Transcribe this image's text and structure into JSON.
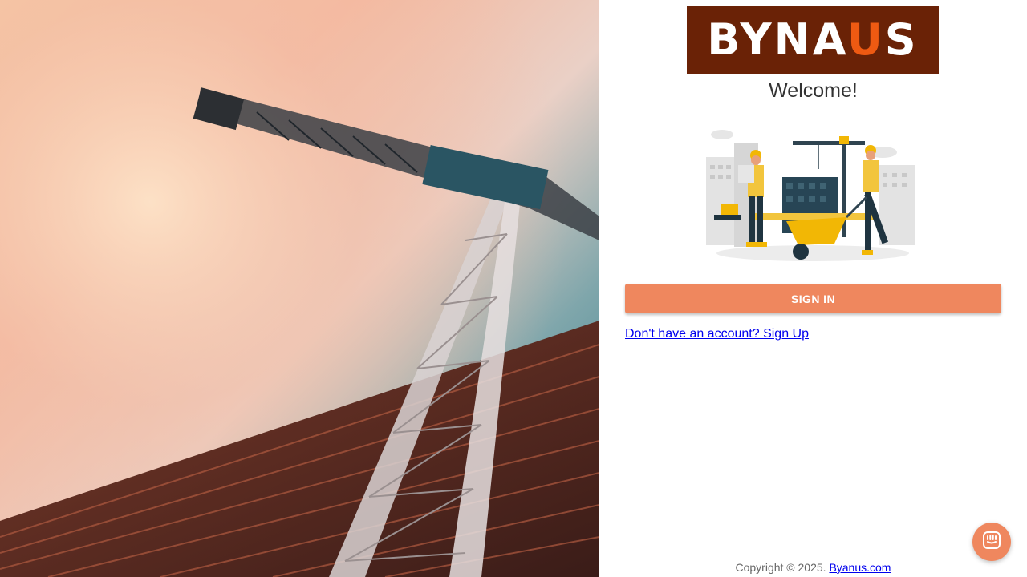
{
  "hero": {
    "image": "construction-crane-photo"
  },
  "brand": {
    "logo_text_part1": "BYNA",
    "logo_text_accent": "U",
    "logo_text_part2": "S",
    "logo_bg_color": "#6a2206",
    "logo_accent_color": "#ef5a12"
  },
  "welcome": {
    "title": "Welcome!"
  },
  "illustration": {
    "image": "construction-workers-illustration"
  },
  "auth": {
    "signin_label": "SIGN IN",
    "signup_link_text": "Don't have an account? Sign Up",
    "button_color": "#ef875e"
  },
  "footer": {
    "copyright_text": "Copyright © 2025.",
    "site_link_text": "Byanus.com"
  },
  "chat": {
    "icon": "chat-bubble-icon"
  }
}
